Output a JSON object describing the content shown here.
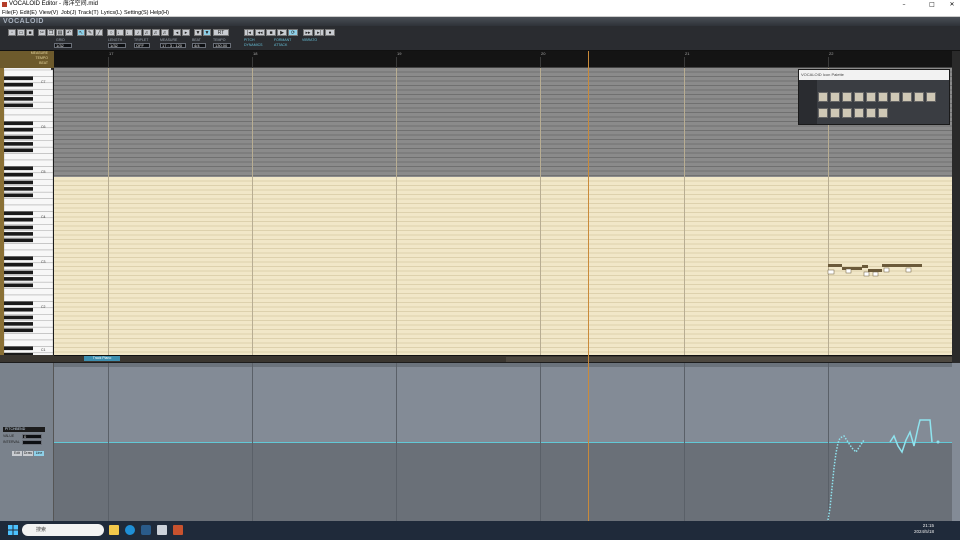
{
  "window": {
    "title": "VOCALOID Editor - 海洋空间.mid",
    "min": "–",
    "max": "□",
    "close": "✕"
  },
  "menu": [
    "File(F)",
    "Edit(E)",
    "View(V)",
    "Job(J)",
    "Track(T)",
    "Lyrics(L)",
    "Setting(S)",
    "Help(H)"
  ],
  "brand": "VOCALOID",
  "toolbar": {
    "fields": [
      {
        "label": "GRID",
        "value": "1/32"
      },
      {
        "label": "LENGTH",
        "value": "1/32"
      },
      {
        "label": "TRIPLET",
        "value": "OFF"
      },
      {
        "label": "MEASURE",
        "value": "17 : 3 : 120"
      },
      {
        "label": "BEAT",
        "value": "4/4"
      },
      {
        "label": "TEMPO",
        "value": "130.00"
      }
    ],
    "options": [
      "PITCH",
      "DYNAMICS",
      "FORMANT",
      "ATTACK",
      "VIBRATO"
    ]
  },
  "ruler": {
    "labels": [
      "MEASURE",
      "TEMPO",
      "BEAT"
    ],
    "bars": [
      "17",
      "18",
      "19",
      "20",
      "21",
      "22"
    ]
  },
  "piano": {
    "octaves": [
      "C7",
      "C6",
      "C5",
      "C4",
      "C3",
      "C2",
      "C1"
    ]
  },
  "track": {
    "tab": "Track Piano"
  },
  "palette": {
    "title": "VOCALOID Icon Palette"
  },
  "control": {
    "panel_labels": [
      "PITCHBEND",
      "VALUE",
      "INTERVAL"
    ],
    "value": "0",
    "buttons": [
      "Edit",
      "Draw",
      "Line"
    ]
  },
  "taskbar": {
    "search": "搜索",
    "time": "21:15",
    "date": "2024/5/18"
  }
}
